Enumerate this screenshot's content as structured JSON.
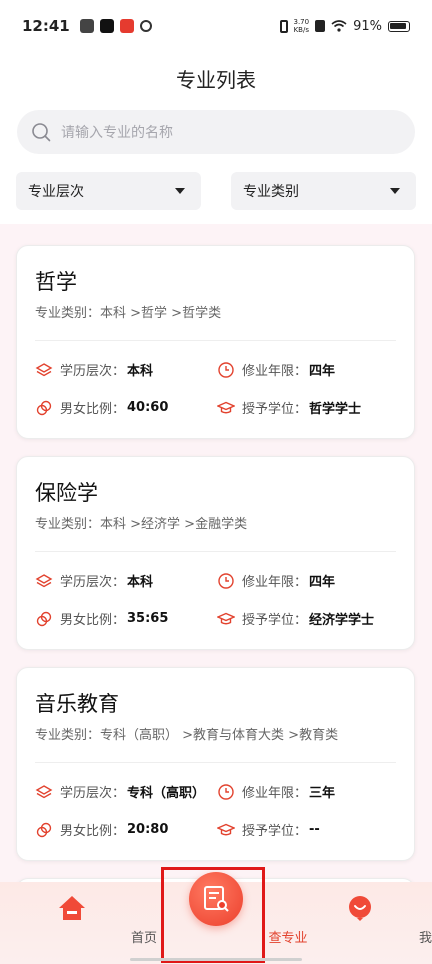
{
  "status_bar": {
    "time": "12:41",
    "net_speed_value": "3.70",
    "net_speed_unit": "KB/s",
    "battery": "91%"
  },
  "header": {
    "title": "专业列表",
    "search_placeholder": "请输入专业的名称",
    "filter_level": "专业层次",
    "filter_category": "专业类别"
  },
  "labels": {
    "category_prefix": "专业类别：",
    "level": "学历层次：",
    "duration": "修业年限：",
    "ratio": "男女比例：",
    "degree": "授予学位："
  },
  "majors": [
    {
      "name": "哲学",
      "category_path": "本科 >哲学 >哲学类",
      "level": "本科",
      "duration": "四年",
      "ratio": "40:60",
      "degree": "哲学学士"
    },
    {
      "name": "保险学",
      "category_path": "本科 >经济学 >金融学类",
      "level": "本科",
      "duration": "四年",
      "ratio": "35:65",
      "degree": "经济学学士"
    },
    {
      "name": "音乐教育",
      "category_path": "专科（高职） >教育与体育大类 >教育类",
      "level": "专科（高职）",
      "duration": "三年",
      "ratio": "20:80",
      "degree": "--"
    }
  ],
  "bottom_nav": {
    "home": "首页",
    "major": "查专业",
    "mine": "我的"
  },
  "colors": {
    "accent": "#e2422e",
    "background": "#fdf3f6"
  }
}
